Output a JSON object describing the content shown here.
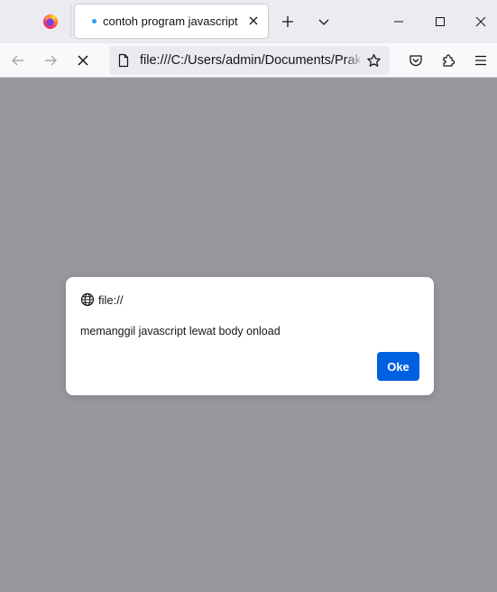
{
  "browser": {
    "tab": {
      "title": "contoh program javascript",
      "status": "loading",
      "close_icon": "close-icon"
    },
    "icons": {
      "app": "firefox-logo-icon",
      "new_tab": "plus-icon",
      "list_tabs": "chevron-down-icon",
      "minimize": "minimize-icon",
      "maximize": "maximize-icon",
      "close": "close-icon",
      "back": "arrow-left-icon",
      "forward": "arrow-right-icon",
      "stop": "close-icon",
      "page": "page-icon",
      "bookmark": "star-icon",
      "pocket": "pocket-icon",
      "extensions": "puzzle-icon",
      "menu": "hamburger-icon"
    },
    "url": "file:///C:/Users/admin/Documents/Praktikum"
  },
  "dialog": {
    "origin": "file://",
    "message": "memanggil javascript lewat body onload",
    "ok_label": "Oke",
    "globe_icon": "globe-icon"
  },
  "colors": {
    "accent": "#0061e0",
    "overlay": "#97979c",
    "tab_indicator": "#2a9df4"
  }
}
